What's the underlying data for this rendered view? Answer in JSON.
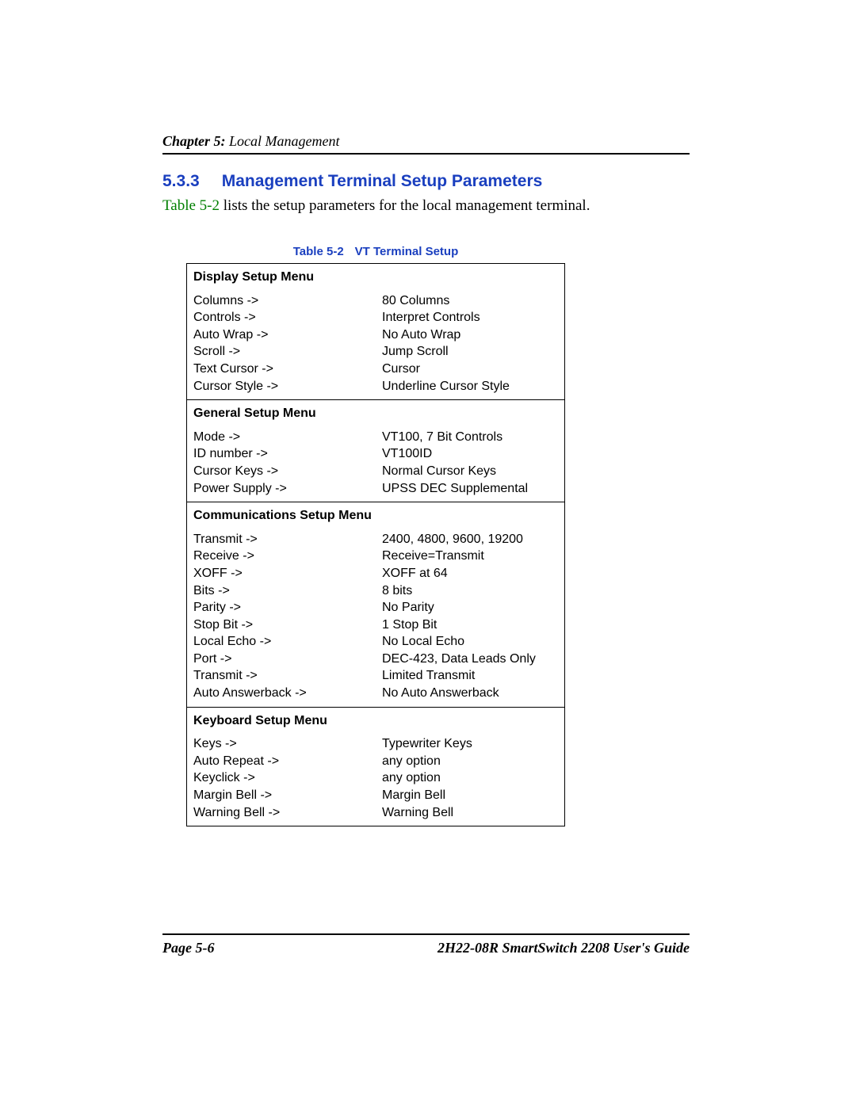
{
  "header": {
    "chapter_label": "Chapter 5:",
    "chapter_title": " Local Management"
  },
  "section": {
    "number": "5.3.3",
    "title": "Management Terminal Setup Parameters"
  },
  "intro": {
    "link_text": "Table 5-2",
    "rest": " lists the setup parameters for the local management terminal."
  },
  "table_caption": {
    "label": "Table 5-2",
    "title": "VT Terminal Setup"
  },
  "groups": [
    {
      "header": "Display Setup Menu",
      "rows": [
        {
          "param": "Columns  ->",
          "value": "80 Columns"
        },
        {
          "param": "Controls ->",
          "value": "Interpret Controls"
        },
        {
          "param": "Auto Wrap ->",
          "value": "No Auto Wrap"
        },
        {
          "param": "Scroll ->",
          "value": "Jump Scroll"
        },
        {
          "param": "Text Cursor ->",
          "value": "Cursor"
        },
        {
          "param": "Cursor Style ->",
          "value": "Underline Cursor Style"
        }
      ]
    },
    {
      "header": "General Setup Menu",
      "rows": [
        {
          "param": "Mode ->",
          "value": "VT100, 7 Bit Controls"
        },
        {
          "param": "ID number ->",
          "value": "VT100ID"
        },
        {
          "param": "Cursor Keys ->",
          "value": "Normal Cursor Keys"
        },
        {
          "param": "Power Supply ->",
          "value": "UPSS DEC Supplemental"
        }
      ]
    },
    {
      "header": "Communications Setup Menu",
      "rows": [
        {
          "param": "Transmit ->",
          "value": "2400, 4800, 9600, 19200"
        },
        {
          "param": "Receive ->",
          "value": "Receive=Transmit"
        },
        {
          "param": "XOFF ->",
          "value": "XOFF at 64"
        },
        {
          "param": "Bits  ->",
          "value": "8 bits"
        },
        {
          "param": "Parity ->",
          "value": "No Parity"
        },
        {
          "param": "Stop Bit ->",
          "value": "1 Stop Bit"
        },
        {
          "param": "Local Echo ->",
          "value": "No Local Echo"
        },
        {
          "param": "Port  ->",
          "value": "DEC-423, Data Leads Only"
        },
        {
          "param": "Transmit ->",
          "value": "Limited Transmit"
        },
        {
          "param": "Auto Answerback ->",
          "value": "No Auto Answerback"
        }
      ]
    },
    {
      "header": "Keyboard Setup Menu",
      "rows": [
        {
          "param": "Keys ->",
          "value": "Typewriter Keys"
        },
        {
          "param": "Auto Repeat ->",
          "value": "any option"
        },
        {
          "param": "Keyclick ->",
          "value": "any option"
        },
        {
          "param": "Margin Bell ->",
          "value": "Margin Bell"
        },
        {
          "param": "Warning Bell ->",
          "value": "Warning Bell"
        }
      ]
    }
  ],
  "footer": {
    "page": "Page 5-6",
    "doc": "2H22-08R SmartSwitch 2208 User's Guide"
  }
}
